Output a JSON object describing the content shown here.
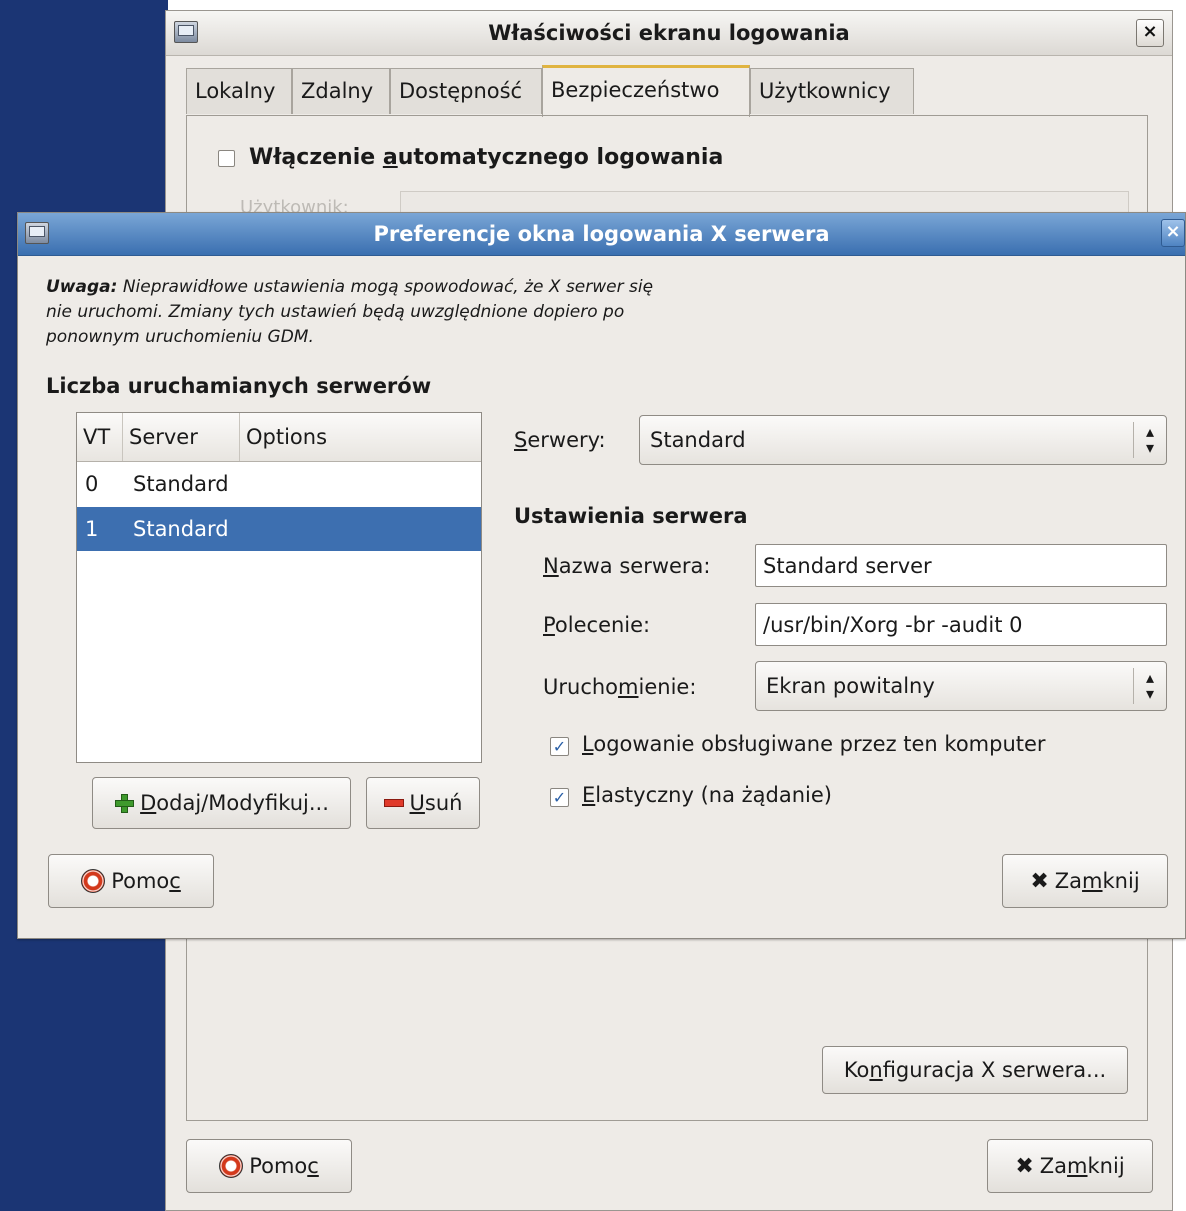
{
  "back_window": {
    "title": "Właściwości ekranu logowania",
    "close_label": "×",
    "tabs": [
      {
        "label": "Lokalny"
      },
      {
        "label": "Zdalny"
      },
      {
        "label": "Dostępność"
      },
      {
        "label": "Bezpieczeństwo",
        "active": true
      },
      {
        "label": "Użytkownicy"
      }
    ],
    "autologin_label_pre": "Włączenie ",
    "autologin_label_u": "a",
    "autologin_label_post": "utomatycznego logowania",
    "autologin_checked": false,
    "user_label_ghost": "Użytkownik:",
    "xserver_button_pre": "Ko",
    "xserver_button_u": "n",
    "xserver_button_post": "figuracja X serwera...",
    "help_pre": "Pomo",
    "help_u": "c",
    "close_btn_pre": "Za",
    "close_btn_u": "m",
    "close_btn_post": "knij"
  },
  "dialog": {
    "title": "Preferencje okna logowania X serwera",
    "close_label": "×",
    "warning_bold": "Uwaga:",
    "warning_text": " Nieprawidłowe ustawienia mogą spowodować, że X serwer się nie uruchomi. Zmiany tych ustawień będą uwzględnione dopiero po ponownym uruchomieniu GDM.",
    "servers_section": "Liczba uruchamianych serwerów",
    "table": {
      "columns": [
        "VT",
        "Server",
        "Options"
      ],
      "rows": [
        {
          "vt": "0",
          "server": "Standard",
          "options": ""
        },
        {
          "vt": "1",
          "server": "Standard",
          "options": "",
          "selected": true
        }
      ]
    },
    "add_btn_u": "D",
    "add_btn_post": "odaj/Modyfikuj...",
    "remove_btn_u": "U",
    "remove_btn_post": "suń",
    "servers_label_u": "S",
    "servers_label_post": "erwery:",
    "servers_value": "Standard",
    "settings_section": "Ustawienia serwera",
    "name_label_u": "N",
    "name_label_post": "azwa serwera:",
    "name_value": "Standard server",
    "cmd_label_u": "P",
    "cmd_label_post": "olecenie:",
    "cmd_value": "/usr/bin/Xorg -br -audit 0",
    "launch_label_pre": "Urucho",
    "launch_label_u": "m",
    "launch_label_post": "ienie:",
    "launch_value": "Ekran powitalny",
    "chk_login_u": "L",
    "chk_login_post": "ogowanie obsługiwane przez ten komputer",
    "chk_login_checked": true,
    "chk_flex_u": "E",
    "chk_flex_post": "lastyczny (na żądanie)",
    "chk_flex_checked": true,
    "help_pre": "Pomo",
    "help_u": "c",
    "close_btn_pre": "Za",
    "close_btn_u": "m",
    "close_btn_post": "knij"
  }
}
